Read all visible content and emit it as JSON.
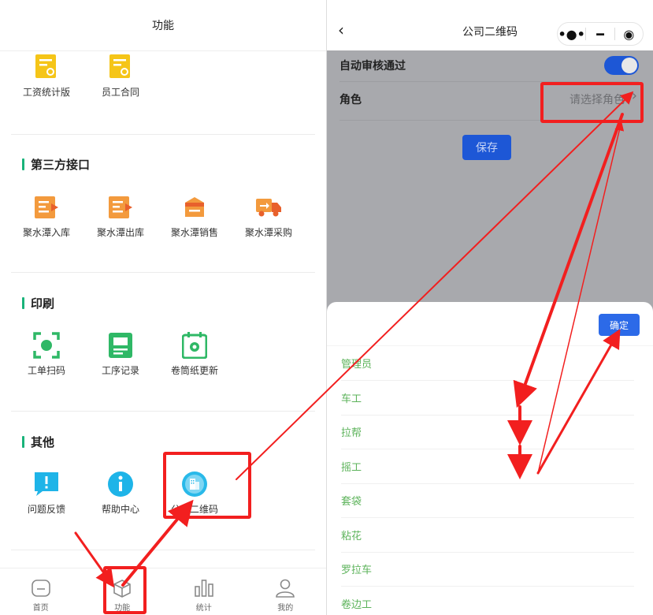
{
  "left": {
    "header_title": "功能",
    "top_items": [
      {
        "label": "工资统计版",
        "icon": "salary-doc-icon"
      },
      {
        "label": "员工合同",
        "icon": "contract-doc-icon"
      }
    ],
    "sections": [
      {
        "title": "第三方接口",
        "items": [
          {
            "label": "聚水潭入库",
            "icon": "stock-in-icon"
          },
          {
            "label": "聚水潭出库",
            "icon": "stock-out-icon"
          },
          {
            "label": "聚水潭销售",
            "icon": "sales-box-icon"
          },
          {
            "label": "聚水潭采购",
            "icon": "purchase-truck-icon"
          }
        ]
      },
      {
        "title": "印刷",
        "items": [
          {
            "label": "工单扫码",
            "icon": "scan-icon"
          },
          {
            "label": "工序记录",
            "icon": "process-record-icon"
          },
          {
            "label": "卷筒纸更新",
            "icon": "roll-paper-calendar-icon"
          }
        ]
      },
      {
        "title": "其他",
        "items": [
          {
            "label": "问题反馈",
            "icon": "feedback-icon"
          },
          {
            "label": "帮助中心",
            "icon": "help-info-icon"
          },
          {
            "label": "公司二维码",
            "icon": "company-qrcode-icon"
          }
        ]
      }
    ],
    "tabs": [
      {
        "label": "首页",
        "icon": "home-icon"
      },
      {
        "label": "功能",
        "icon": "function-cube-icon"
      },
      {
        "label": "统计",
        "icon": "stats-bar-icon"
      },
      {
        "label": "我的",
        "icon": "profile-icon"
      }
    ]
  },
  "right": {
    "back_symbol": "‹",
    "title": "公司二维码",
    "capsule": {
      "more": "•●•",
      "minimize": "━",
      "close": "◉"
    },
    "auto_approve_label": "自动审核通过",
    "auto_approve_on": true,
    "role_label": "角色",
    "role_placeholder": "请选择角色",
    "save_label": "保存",
    "confirm_label": "确定",
    "options": [
      "管理员",
      "车工",
      "拉帮",
      "摇工",
      "套袋",
      "粘花",
      "罗拉车",
      "卷边工"
    ]
  },
  "colors": {
    "accent_green": "#19b37a",
    "primary_blue": "#1d57d6",
    "option_green": "#5db35b",
    "annotation_red": "#f21f1f",
    "overlay_gray": "#a8a9ad"
  }
}
